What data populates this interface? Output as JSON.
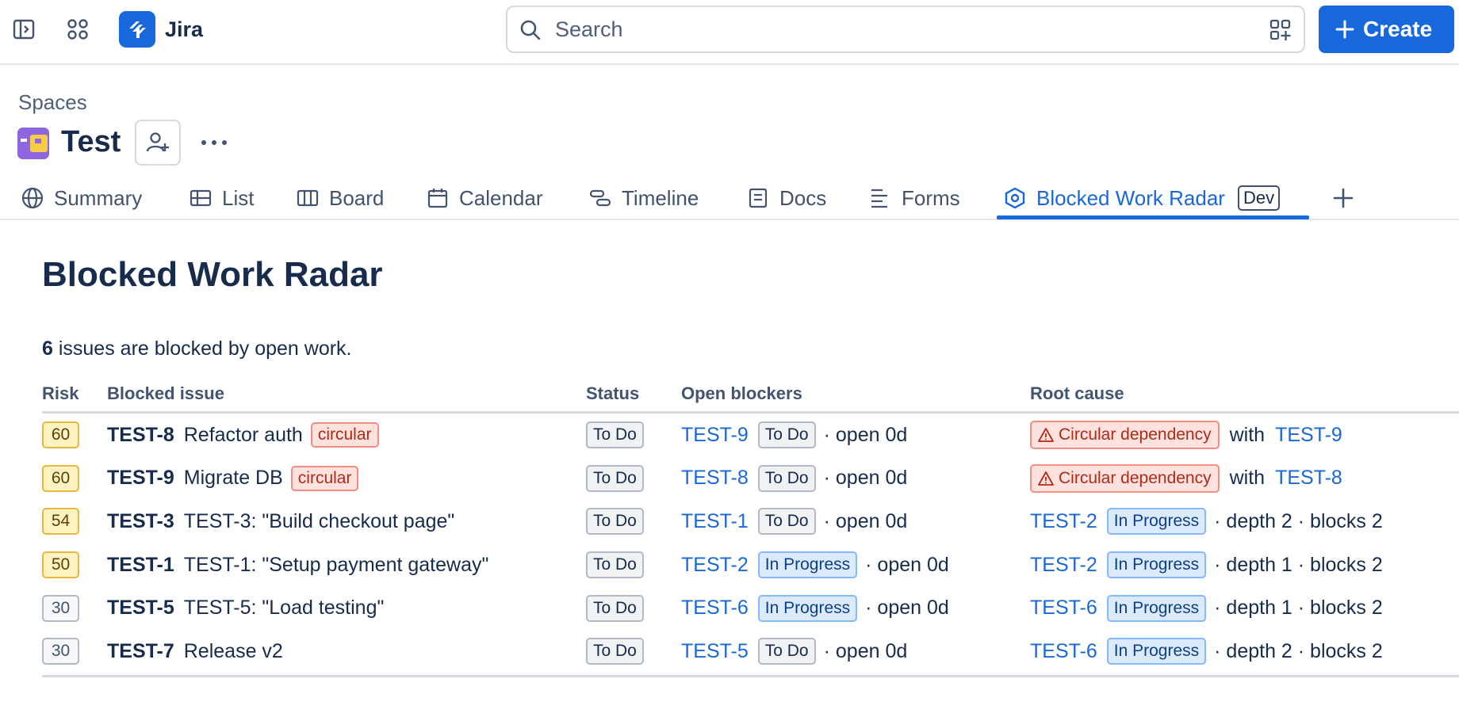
{
  "topbar": {
    "brand": "Jira",
    "search": {
      "placeholder": "Search"
    },
    "create_label": "Create"
  },
  "space": {
    "breadcrumb": "Spaces",
    "title": "Test"
  },
  "tabs": [
    {
      "label": "Summary",
      "icon": "globe-icon"
    },
    {
      "label": "List",
      "icon": "list-icon"
    },
    {
      "label": "Board",
      "icon": "board-icon"
    },
    {
      "label": "Calendar",
      "icon": "calendar-icon"
    },
    {
      "label": "Timeline",
      "icon": "timeline-icon"
    },
    {
      "label": "Docs",
      "icon": "docs-icon"
    },
    {
      "label": "Forms",
      "icon": "forms-icon"
    },
    {
      "label": "Blocked Work Radar",
      "icon": "radar-icon",
      "badge": "Dev",
      "active": true
    }
  ],
  "main": {
    "title": "Blocked Work Radar",
    "summary_count": "6",
    "summary_text": " issues are blocked by open work.",
    "columns": {
      "risk": "Risk",
      "blocked_issue": "Blocked issue",
      "status": "Status",
      "open_blockers": "Open blockers",
      "root_cause": "Root cause"
    },
    "rows": [
      {
        "risk": "60",
        "key": "TEST-8",
        "summary": "Refactor auth",
        "tag": "circular",
        "status": "To Do",
        "blocker_key": "TEST-9",
        "blocker_status": "To Do",
        "blocker_meta": "· open 0d",
        "root_circular": "Circular dependency",
        "root_with": "with",
        "root_key": "TEST-9"
      },
      {
        "risk": "60",
        "key": "TEST-9",
        "summary": "Migrate DB",
        "tag": "circular",
        "status": "To Do",
        "blocker_key": "TEST-8",
        "blocker_status": "To Do",
        "blocker_meta": "· open 0d",
        "root_circular": "Circular dependency",
        "root_with": "with",
        "root_key": "TEST-8"
      },
      {
        "risk": "54",
        "key": "TEST-3",
        "summary": "TEST-3: \"Build checkout page\"",
        "status": "To Do",
        "blocker_key": "TEST-1",
        "blocker_status": "To Do",
        "blocker_meta": "· open 0d",
        "root_key": "TEST-2",
        "root_status": "In Progress",
        "root_meta": "· depth 2 · blocks 2"
      },
      {
        "risk": "50",
        "key": "TEST-1",
        "summary": "TEST-1: \"Setup payment gateway\"",
        "status": "To Do",
        "blocker_key": "TEST-2",
        "blocker_status": "In Progress",
        "blocker_meta": "· open 0d",
        "root_key": "TEST-2",
        "root_status": "In Progress",
        "root_meta": "· depth 1 · blocks 2"
      },
      {
        "risk": "30",
        "key": "TEST-5",
        "summary": "TEST-5: \"Load testing\"",
        "status": "To Do",
        "blocker_key": "TEST-6",
        "blocker_status": "In Progress",
        "blocker_meta": "· open 0d",
        "root_key": "TEST-6",
        "root_status": "In Progress",
        "root_meta": "· depth 1 · blocks 2"
      },
      {
        "risk": "30",
        "key": "TEST-7",
        "summary": "Release v2",
        "status": "To Do",
        "blocker_key": "TEST-5",
        "blocker_status": "To Do",
        "blocker_meta": "· open 0d",
        "root_key": "TEST-6",
        "root_status": "In Progress",
        "root_meta": "· depth 2 · blocks 2"
      }
    ]
  },
  "colors": {
    "accent": "#1868db",
    "risk_high_bg": "#fff2c2",
    "risk_low_bg": "#f7f8f9",
    "danger_bg": "#ffe2dd",
    "danger_text": "#ae2a19",
    "in_progress_bg": "#dceafe"
  }
}
